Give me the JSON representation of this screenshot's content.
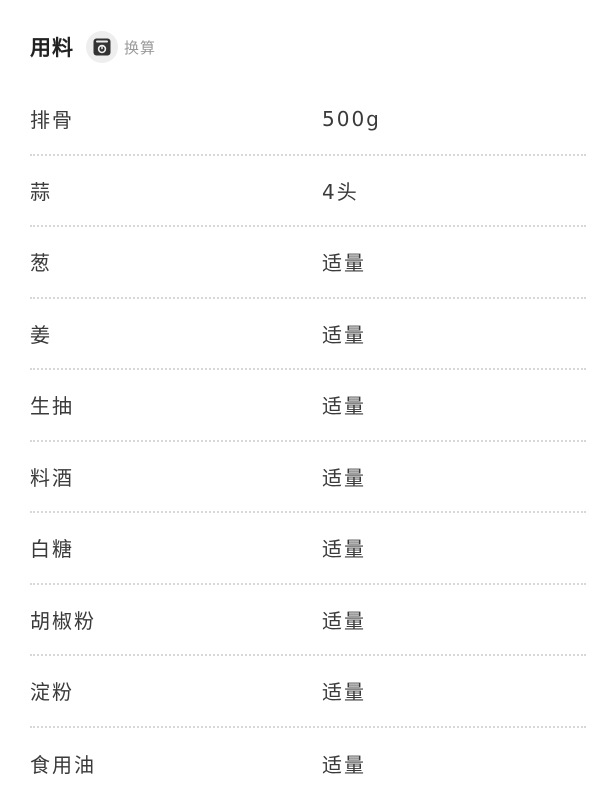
{
  "header": {
    "title": "用料",
    "scale_icon": "kitchen-scale-icon",
    "scale_label": "换算"
  },
  "ingredients": [
    {
      "name": "排骨",
      "amount": "500g"
    },
    {
      "name": "蒜",
      "amount": "4头"
    },
    {
      "name": "葱",
      "amount": "适量"
    },
    {
      "name": "姜",
      "amount": "适量"
    },
    {
      "name": "生抽",
      "amount": "适量"
    },
    {
      "name": "料酒",
      "amount": "适量"
    },
    {
      "name": "白糖",
      "amount": "适量"
    },
    {
      "name": "胡椒粉",
      "amount": "适量"
    },
    {
      "name": "淀粉",
      "amount": "适量"
    },
    {
      "name": "食用油",
      "amount": "适量"
    }
  ],
  "colors": {
    "text": "#3a3a3a",
    "muted": "#9a9a9a",
    "divider": "#d8d8d8",
    "icon_bg": "#eeeeee"
  }
}
